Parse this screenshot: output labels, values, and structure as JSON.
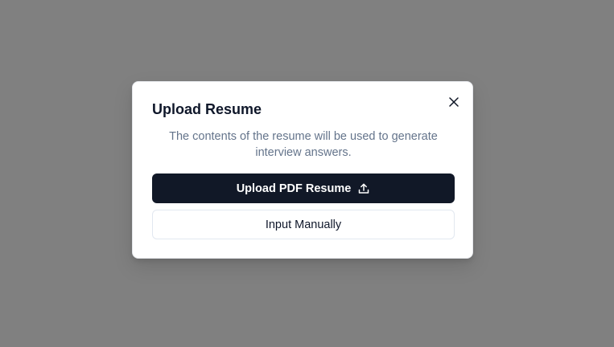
{
  "dialog": {
    "title": "Upload Resume",
    "description": "The contents of the resume will be used to generate interview answers.",
    "close_icon": "close-icon",
    "upload_button_label": "Upload PDF Resume",
    "upload_icon": "upload-icon",
    "manual_button_label": "Input Manually"
  },
  "colors": {
    "overlay": "#808080",
    "primary_button": "#111827",
    "description_text": "#64748b"
  }
}
